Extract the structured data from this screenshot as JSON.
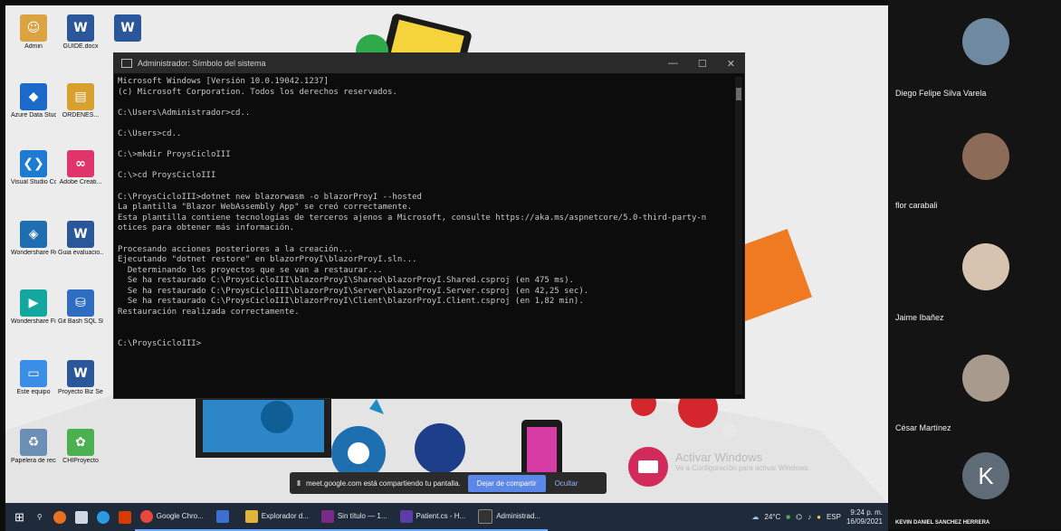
{
  "desktop_icons": [
    {
      "label": "Admin",
      "icon": "user-folder-icon",
      "color": "#d9a441"
    },
    {
      "label": "GUIDE.docx",
      "icon": "word-icon",
      "color": "#2b579a"
    },
    {
      "label": "",
      "icon": "word-icon",
      "color": "#2b579a"
    },
    {
      "label": "Azure Data Studio",
      "icon": "azure-data-studio-icon",
      "color": "#1b6ac9"
    },
    {
      "label": "ORDENES...",
      "icon": "archive-icon",
      "color": "#d8a12f"
    },
    {
      "label": "Visual Studio Code",
      "icon": "vscode-icon",
      "color": "#1e7bd2"
    },
    {
      "label": "Adobe Creati...",
      "icon": "adobe-cc-icon",
      "color": "#e0356b"
    },
    {
      "label": "Wondershare Recoverit",
      "icon": "recoverit-icon",
      "color": "#1f6fb0"
    },
    {
      "label": "Guia evaluacio...",
      "icon": "word-icon",
      "color": "#2b579a"
    },
    {
      "label": "Wondershare Filmora9",
      "icon": "filmora-icon",
      "color": "#14a7a0"
    },
    {
      "label": "Git Bash SQL Studi...",
      "icon": "database-icon",
      "color": "#2d6cc0"
    },
    {
      "label": "Este equipo",
      "icon": "this-pc-icon",
      "color": "#3a8ee6"
    },
    {
      "label": "Proyecto Biz Seguridad...",
      "icon": "word-icon",
      "color": "#2b579a"
    },
    {
      "label": "Papelera de reciclaje",
      "icon": "recycle-bin-icon",
      "color": "#6c8fb5"
    },
    {
      "label": "CHIProyecto",
      "icon": "green-app-icon",
      "color": "#4caf50"
    }
  ],
  "cmd_window": {
    "title": "Administrador: Símbolo del sistema",
    "minimize": "—",
    "maximize": "☐",
    "close": "✕",
    "lines": [
      "Microsoft Windows [Versión 10.0.19042.1237]",
      "(c) Microsoft Corporation. Todos los derechos reservados.",
      "",
      "C:\\Users\\Administrador>cd..",
      "",
      "C:\\Users>cd..",
      "",
      "C:\\>mkdir ProysCicloIII",
      "",
      "C:\\>cd ProysCicloIII",
      "",
      "C:\\ProysCicloIII>dotnet new blazorwasm -o blazorProyI --hosted",
      "La plantilla \"Blazor WebAssembly App\" se creó correctamente.",
      "Esta plantilla contiene tecnologías de terceros ajenos a Microsoft, consulte https://aka.ms/aspnetcore/5.0-third-party-n",
      "otices para obtener más información.",
      "",
      "Procesando acciones posteriores a la creación...",
      "Ejecutando \"dotnet restore\" en blazorProyI\\blazorProyI.sln...",
      "  Determinando los proyectos que se van a restaurar...",
      "  Se ha restaurado C:\\ProysCicloIII\\blazorProyI\\Shared\\blazorProyI.Shared.csproj (en 475 ms).",
      "  Se ha restaurado C:\\ProysCicloIII\\blazorProyI\\Server\\blazorProyI.Server.csproj (en 42,25 sec).",
      "  Se ha restaurado C:\\ProysCicloIII\\blazorProyI\\Client\\blazorProyI.Client.csproj (en 1,82 min).",
      "Restauración realizada correctamente.",
      "",
      "",
      "C:\\ProysCicloIII>"
    ]
  },
  "share_bar": {
    "pause_icon": "‖",
    "message": "meet.google.com está compartiendo tu pantalla.",
    "stop_label": "Dejar de compartir",
    "hide_label": "Ocultar"
  },
  "watermark": {
    "title": "Activar Windows",
    "subtitle": "Ve a Configuración para activar Windows."
  },
  "taskbar": {
    "tasks": [
      {
        "label": "Google Chro...",
        "icon": "chrome-icon",
        "color": "#e9473b"
      },
      {
        "label": "",
        "icon": "meet-icon",
        "color": "#3b6fd1"
      },
      {
        "label": "Explorador d...",
        "icon": "folder-icon",
        "color": "#e2b33a"
      },
      {
        "label": "Sin título — 1...",
        "icon": "xd-icon",
        "color": "#7b2a86"
      },
      {
        "label": "Patient.cs - H...",
        "icon": "visual-studio-icon",
        "color": "#5b3da6"
      },
      {
        "label": "Administrad...",
        "icon": "cmd-icon",
        "color": "#333333"
      }
    ],
    "weather": "24°C",
    "language": "ESP",
    "time": "9:24 p. m.",
    "date": "16/09/2021"
  },
  "participants": [
    {
      "name": "Diego Felipe Silva Varela",
      "avatar_color": "#6f8aa0"
    },
    {
      "name": "flor carabali",
      "avatar_color": "#8c6b58"
    },
    {
      "name": "Jaime Ibañez",
      "avatar_color": "#d7c4b0"
    },
    {
      "name": "César Martínez",
      "avatar_color": "#a89a8c"
    },
    {
      "name": "KEVIN DANIEL SANCHEZ HERRERA",
      "avatar_letter": "K",
      "avatar_color": "#5f6b76"
    }
  ]
}
